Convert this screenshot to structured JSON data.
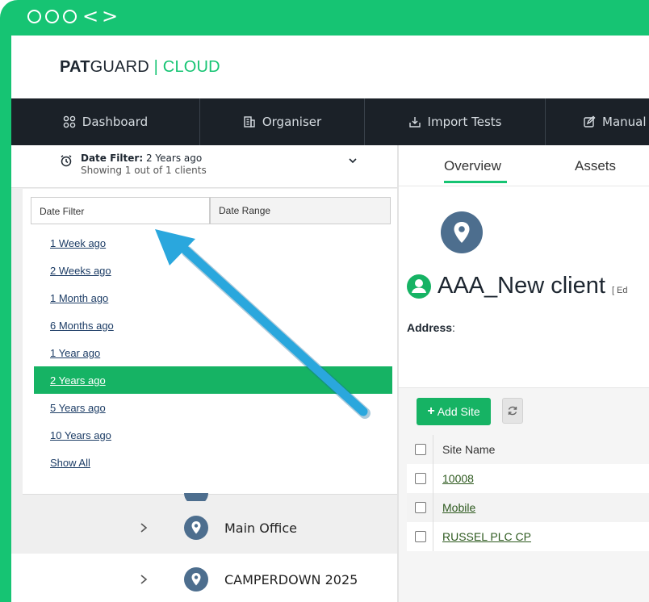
{
  "brand": {
    "part1": "PAT",
    "part2": "GUARD",
    "sep": " | ",
    "part3": "CLOUD"
  },
  "nav": {
    "items": [
      {
        "label": "Dashboard",
        "icon": "grid-icon"
      },
      {
        "label": "Organiser",
        "icon": "building-icon"
      },
      {
        "label": "Import Tests",
        "icon": "import-icon"
      },
      {
        "label": "Manual",
        "icon": "edit-icon"
      }
    ]
  },
  "filter": {
    "label": "Date Filter:",
    "value": "2 Years ago",
    "showing": "Showing 1 out of 1 clients"
  },
  "dropdown": {
    "tabs": [
      "Date Filter",
      "Date Range"
    ],
    "options": [
      "1 Week ago",
      "2 Weeks ago",
      "1 Month ago",
      "6 Months ago",
      "1 Year ago",
      "2 Years ago",
      "5 Years ago",
      "10 Years ago",
      "Show All"
    ],
    "selected_index": 5
  },
  "tree": {
    "items": [
      "Main Office",
      "CAMPERDOWN 2025"
    ]
  },
  "right": {
    "tabs": [
      "Overview",
      "Assets"
    ],
    "client_name": "AAA_New client",
    "edit_label": "[ Ed",
    "address_label": "Address",
    "address_colon": ":",
    "add_site": "Add Site",
    "table": {
      "header": "Site Name",
      "rows": [
        "10008",
        "Mobile",
        "RUSSEL PLC CP"
      ]
    }
  },
  "colors": {
    "accent": "#16c473",
    "nav_bg": "#1b2128",
    "pin": "#4d6e8e",
    "arrow": "#2aa7dd"
  }
}
